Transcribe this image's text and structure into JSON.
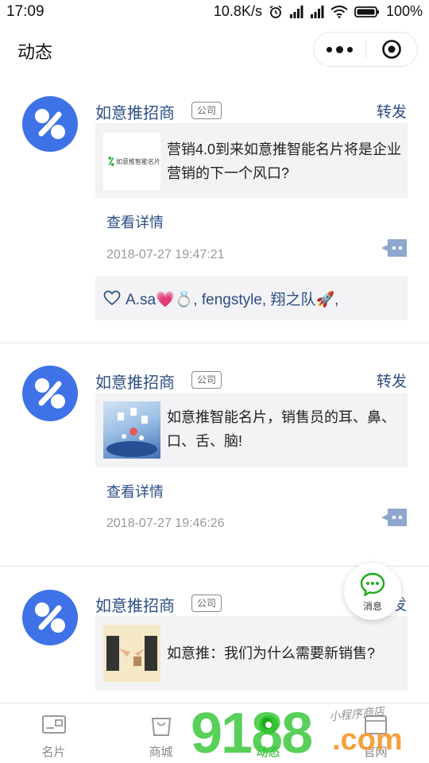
{
  "status_bar": {
    "time": "17:09",
    "network_speed": "10.8K/s",
    "battery": "100%"
  },
  "nav": {
    "title": "动态"
  },
  "posts": [
    {
      "author": "如意推招商",
      "tag": "公司",
      "share_label": "转发",
      "card_text": "营销4.0到来如意推智能名片将是企业营销的下一个风口?",
      "thumb_caption": "如意推智能名片",
      "detail_label": "查看详情",
      "time": "2018-07-27 19:47:21",
      "likes": {
        "names": "A.sa💗💍, fengstyle, 翔之队🚀,"
      }
    },
    {
      "author": "如意推招商",
      "tag": "公司",
      "share_label": "转发",
      "card_text": "如意推智能名片，销售员的耳、鼻、口、舌、脑!",
      "detail_label": "查看详情",
      "time": "2018-07-27 19:46:26"
    },
    {
      "author": "如意推招商",
      "tag": "公司",
      "share_label": "转发",
      "card_text": "如意推：我们为什么需要新销售?"
    }
  ],
  "fab": {
    "label": "消息",
    "icon": "chat-bubble-icon",
    "color": "#1aad19"
  },
  "tabs": [
    {
      "label": "名片",
      "icon": "card-icon"
    },
    {
      "label": "商城",
      "icon": "shopping-bag-icon"
    },
    {
      "label": "动态",
      "icon": "moments-icon",
      "active": true
    },
    {
      "label": "官网",
      "icon": "website-icon"
    }
  ],
  "watermark": {
    "big": "9188",
    "small": "小程序商店",
    "suffix": ".com"
  },
  "colors": {
    "link": "#2d4d86",
    "avatar": "#3f72e6",
    "accent_green": "#1aad19"
  }
}
